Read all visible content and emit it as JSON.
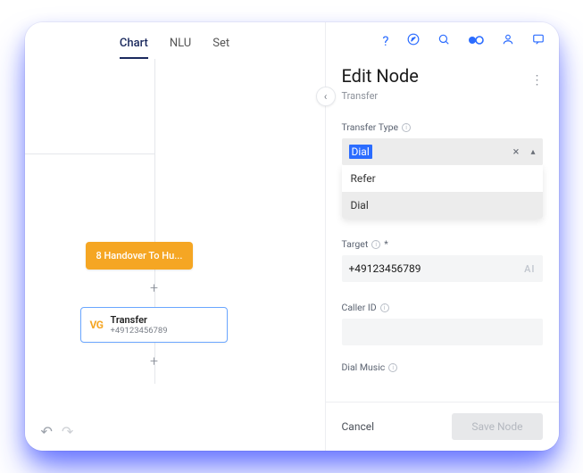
{
  "tabs": {
    "chart": "Chart",
    "nlu": "NLU",
    "settings": "Set"
  },
  "canvas": {
    "orange_node_label": "8 Handover To Hu...",
    "transfer_node": {
      "icon_text": "VG",
      "title": "Transfer",
      "subtitle": "+49123456789"
    }
  },
  "panel": {
    "title": "Edit Node",
    "subtitle": "Transfer",
    "fields": {
      "transfer_type": {
        "label": "Transfer Type",
        "value": "Dial",
        "options": [
          "Refer",
          "Dial"
        ]
      },
      "target": {
        "label": "Target",
        "required": "*",
        "value": "+49123456789"
      },
      "caller_id": {
        "label": "Caller ID"
      },
      "dial_music": {
        "label": "Dial Music"
      }
    },
    "footer": {
      "cancel": "Cancel",
      "save": "Save Node"
    }
  }
}
